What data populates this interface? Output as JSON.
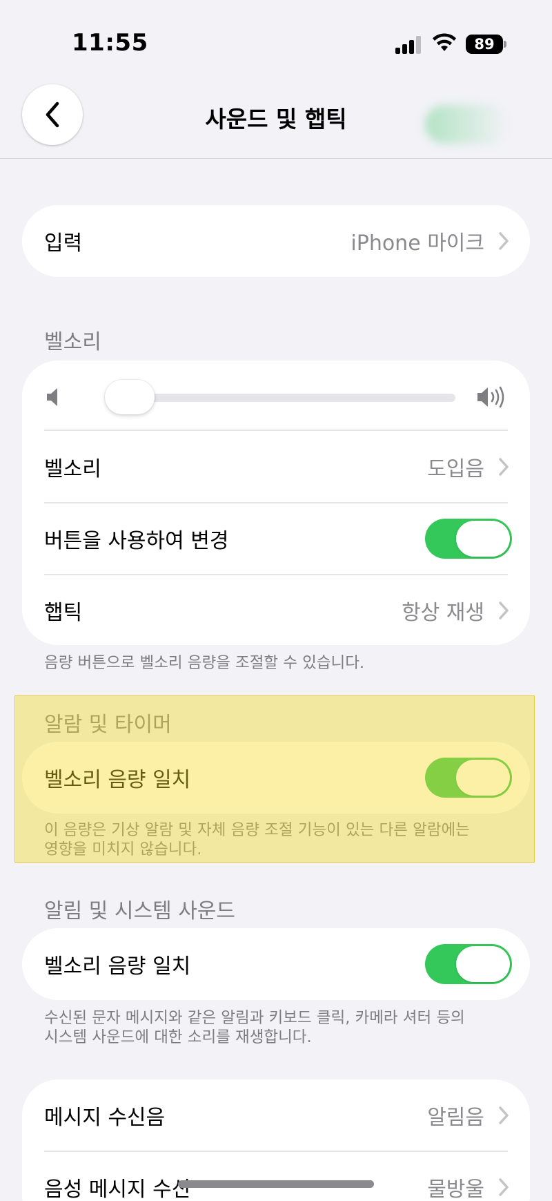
{
  "status_bar": {
    "time": "11:55",
    "battery": "89"
  },
  "nav": {
    "title": "사운드 및 햅틱",
    "back_icon": "chevron-left-icon"
  },
  "input_group": {
    "label": "입력",
    "value": "iPhone 마이크"
  },
  "ringtone_section": {
    "header": "벨소리",
    "volume_level": 0.0,
    "rows": [
      {
        "label": "벨소리",
        "value": "도입음"
      },
      {
        "label": "버튼을 사용하여 변경",
        "toggle": true
      },
      {
        "label": "햅틱",
        "value": "항상 재생"
      }
    ],
    "footnote": "음량 버튼으로 벨소리 음량을 조절할 수 있습니다."
  },
  "alarm_section": {
    "header": "알람 및 타이머",
    "row": {
      "label": "벨소리 음량 일치",
      "toggle": true
    },
    "footnote_lines": [
      "이 음량은 기상 알람 및 자체 음량 조절 기능이 있는 다른 알람에는",
      "영향을 미치지 않습니다."
    ]
  },
  "system_section": {
    "header": "알림 및 시스템 사운드",
    "row": {
      "label": "벨소리 음량 일치",
      "toggle": true
    },
    "footnote_lines": [
      "수신된 문자 메시지와 같은 알림과 키보드 클릭, 카메라 셔터 등의",
      "시스템 사운드에 대한 소리를 재생합니다."
    ]
  },
  "sounds_group": {
    "rows": [
      {
        "label": "메시지 수신음",
        "value": "알림음"
      },
      {
        "label": "음성 메시지 수신",
        "value": "물방울"
      }
    ]
  },
  "colors": {
    "toggle_on": "#34c759",
    "background": "#f2f2f7",
    "highlight": "#f5dc28"
  }
}
